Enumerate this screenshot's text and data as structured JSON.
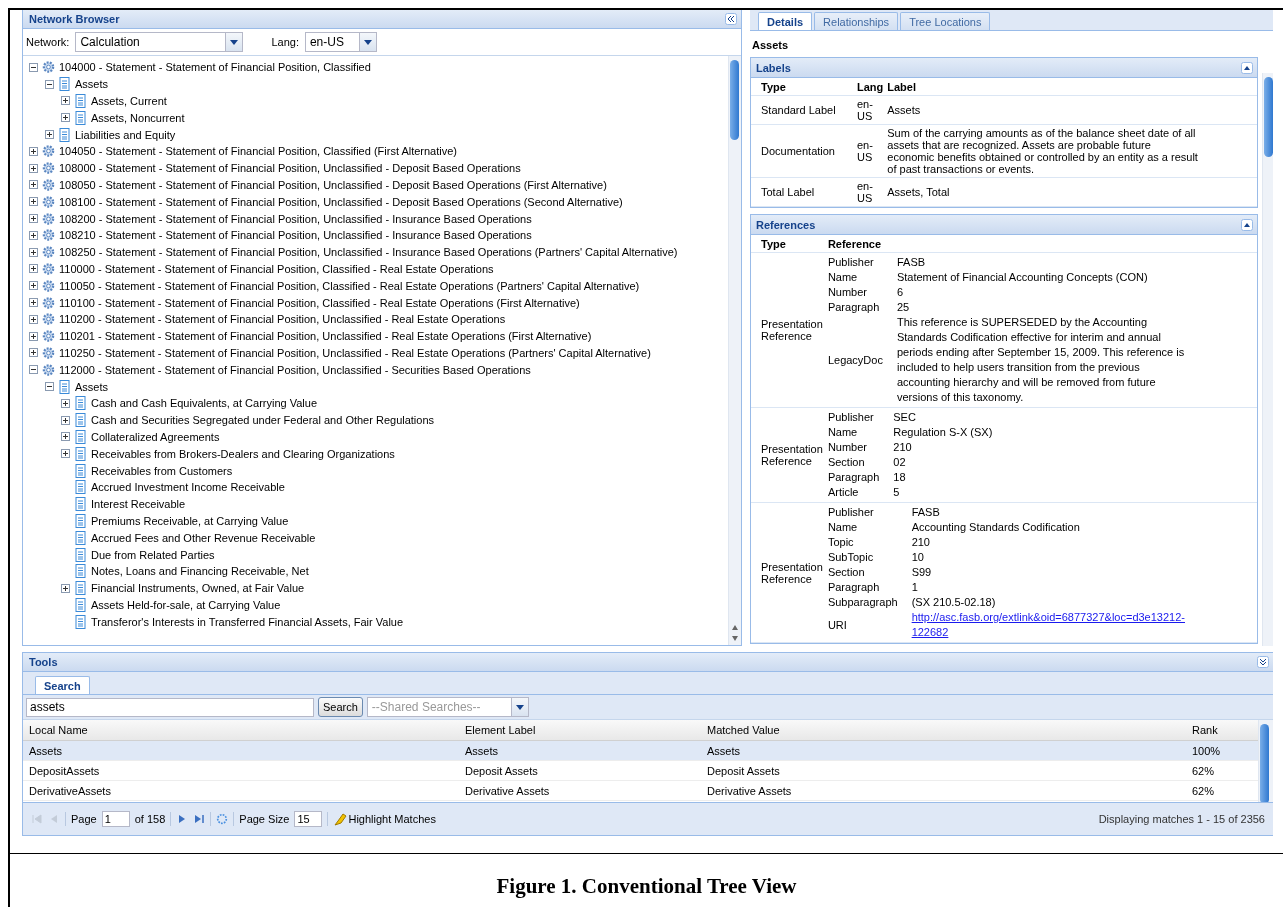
{
  "network_browser": {
    "title": "Network Browser",
    "network_label": "Network:",
    "network_value": "Calculation",
    "lang_label": "Lang:",
    "lang_value": "en-US",
    "tree": [
      {
        "text": "104000 - Statement - Statement of Financial Position, Classified",
        "kind": "network",
        "expanded": true,
        "children": [
          {
            "text": "Assets",
            "kind": "concept",
            "expanded": true,
            "children": [
              {
                "text": "Assets, Current",
                "kind": "concept",
                "expanded": false
              },
              {
                "text": "Assets, Noncurrent",
                "kind": "concept",
                "expanded": false
              }
            ]
          },
          {
            "text": "Liabilities and Equity",
            "kind": "concept",
            "expanded": false
          }
        ]
      },
      {
        "text": "104050 - Statement - Statement of Financial Position, Classified (First Alternative)",
        "kind": "network",
        "expanded": false
      },
      {
        "text": "108000 - Statement - Statement of Financial Position, Unclassified - Deposit Based Operations",
        "kind": "network",
        "expanded": false
      },
      {
        "text": "108050 - Statement - Statement of Financial Position, Unclassified - Deposit Based Operations (First Alternative)",
        "kind": "network",
        "expanded": false
      },
      {
        "text": "108100 - Statement - Statement of Financial Position, Unclassified - Deposit Based Operations (Second Alternative)",
        "kind": "network",
        "expanded": false
      },
      {
        "text": "108200 - Statement - Statement of Financial Position, Unclassified - Insurance Based Operations",
        "kind": "network",
        "expanded": false
      },
      {
        "text": "108210 - Statement - Statement of Financial Position, Unclassified - Insurance Based Operations",
        "kind": "network",
        "expanded": false
      },
      {
        "text": "108250 - Statement - Statement of Financial Position, Unclassified - Insurance Based Operations (Partners' Capital Alternative)",
        "kind": "network",
        "expanded": false
      },
      {
        "text": "110000 - Statement - Statement of Financial Position, Classified - Real Estate Operations",
        "kind": "network",
        "expanded": false
      },
      {
        "text": "110050 - Statement - Statement of Financial Position, Classified - Real Estate Operations (Partners' Capital Alternative)",
        "kind": "network",
        "expanded": false
      },
      {
        "text": "110100 - Statement - Statement of Financial Position, Classified - Real Estate Operations (First Alternative)",
        "kind": "network",
        "expanded": false
      },
      {
        "text": "110200 - Statement - Statement of Financial Position, Unclassified - Real Estate Operations",
        "kind": "network",
        "expanded": false
      },
      {
        "text": "110201 - Statement - Statement of Financial Position, Unclassified - Real Estate Operations (First Alternative)",
        "kind": "network",
        "expanded": false
      },
      {
        "text": "110250 - Statement - Statement of Financial Position, Unclassified - Real Estate Operations (Partners' Capital Alternative)",
        "kind": "network",
        "expanded": false
      },
      {
        "text": "112000 - Statement - Statement of Financial Position, Unclassified - Securities Based Operations",
        "kind": "network",
        "expanded": true,
        "children": [
          {
            "text": "Assets",
            "kind": "concept",
            "expanded": true,
            "children": [
              {
                "text": "Cash and Cash Equivalents, at Carrying Value",
                "kind": "concept",
                "expanded": false
              },
              {
                "text": "Cash and Securities Segregated under Federal and Other Regulations",
                "kind": "concept",
                "expanded": false
              },
              {
                "text": "Collateralized Agreements",
                "kind": "concept",
                "expanded": false
              },
              {
                "text": "Receivables from Brokers-Dealers and Clearing Organizations",
                "kind": "concept",
                "expanded": false
              },
              {
                "text": "Receivables from Customers",
                "kind": "leaf"
              },
              {
                "text": "Accrued Investment Income Receivable",
                "kind": "leaf"
              },
              {
                "text": "Interest Receivable",
                "kind": "leaf"
              },
              {
                "text": "Premiums Receivable, at Carrying Value",
                "kind": "leaf"
              },
              {
                "text": "Accrued Fees and Other Revenue Receivable",
                "kind": "leaf"
              },
              {
                "text": "Due from Related Parties",
                "kind": "leaf"
              },
              {
                "text": "Notes, Loans and Financing Receivable, Net",
                "kind": "leaf"
              },
              {
                "text": "Financial Instruments, Owned, at Fair Value",
                "kind": "concept",
                "expanded": false
              },
              {
                "text": "Assets Held-for-sale, at Carrying Value",
                "kind": "leaf"
              },
              {
                "text": "Transferor's Interests in Transferred Financial Assets, Fair Value",
                "kind": "leaf"
              }
            ]
          }
        ]
      }
    ]
  },
  "details": {
    "tabs": [
      {
        "label": "Details",
        "selected": true
      },
      {
        "label": "Relationships",
        "selected": false
      },
      {
        "label": "Tree Locations",
        "selected": false
      }
    ],
    "heading": "Assets",
    "labels": {
      "title": "Labels",
      "columns": [
        "Type",
        "Lang",
        "Label"
      ],
      "rows": [
        {
          "type": "Standard Label",
          "lang": "en-US",
          "label": "Assets"
        },
        {
          "type": "Documentation",
          "lang": "en-US",
          "label": "Sum of the carrying amounts as of the balance sheet date of all assets that are recognized. Assets are probable future economic benefits obtained or controlled by an entity as a result of past transactions or events."
        },
        {
          "type": "Total Label",
          "lang": "en-US",
          "label": "Assets, Total"
        }
      ]
    },
    "references": {
      "title": "References",
      "columns": [
        "Type",
        "Reference"
      ],
      "rows": [
        {
          "type": "Presentation Reference",
          "fields": [
            {
              "key": "Publisher",
              "value": "FASB"
            },
            {
              "key": "Name",
              "value": "Statement of Financial Accounting Concepts (CON)"
            },
            {
              "key": "Number",
              "value": "6"
            },
            {
              "key": "Paragraph",
              "value": "25"
            },
            {
              "key": "LegacyDoc",
              "value": "This reference is SUPERSEDED by the Accounting Standards Codification effective for interim and annual periods ending after September 15, 2009. This reference is included to help users transition from the previous accounting hierarchy and will be removed from future versions of this taxonomy."
            }
          ]
        },
        {
          "type": "Presentation Reference",
          "fields": [
            {
              "key": "Publisher",
              "value": "SEC"
            },
            {
              "key": "Name",
              "value": "Regulation S-X (SX)"
            },
            {
              "key": "Number",
              "value": "210"
            },
            {
              "key": "Section",
              "value": "02"
            },
            {
              "key": "Paragraph",
              "value": "18"
            },
            {
              "key": "Article",
              "value": "5"
            }
          ]
        },
        {
          "type": "Presentation Reference",
          "fields": [
            {
              "key": "Publisher",
              "value": "FASB"
            },
            {
              "key": "Name",
              "value": "Accounting Standards Codification"
            },
            {
              "key": "Topic",
              "value": "210"
            },
            {
              "key": "SubTopic",
              "value": "10"
            },
            {
              "key": "Section",
              "value": "S99"
            },
            {
              "key": "Paragraph",
              "value": "1"
            },
            {
              "key": "Subparagraph",
              "value": "(SX 210.5-02.18)"
            },
            {
              "key": "URI",
              "value": "http://asc.fasb.org/extlink&oid=6877327&loc=d3e13212-122682",
              "kind": "link"
            }
          ]
        }
      ]
    }
  },
  "tools": {
    "title": "Tools",
    "tabs": [
      {
        "label": "Search",
        "selected": true
      }
    ],
    "search_value": "assets",
    "search_button": "Search",
    "shared_placeholder": "--Shared Searches--",
    "columns": [
      "Local Name",
      "Element Label",
      "Matched Value",
      "Rank"
    ],
    "rows": [
      {
        "cells": [
          "Assets",
          "Assets",
          "Assets",
          "100%"
        ],
        "selected": true
      },
      {
        "cells": [
          "DepositAssets",
          "Deposit Assets",
          "Deposit Assets",
          "62%"
        ],
        "selected": false
      },
      {
        "cells": [
          "DerivativeAssets",
          "Derivative Assets",
          "Derivative Assets",
          "62%"
        ],
        "selected": false
      }
    ],
    "paging": {
      "page_label": "Page",
      "page": "1",
      "of": "of 158",
      "size_label": "Page Size",
      "size": "15",
      "highlight": "Highlight Matches",
      "status": "Displaying matches 1 - 15 of 2356"
    }
  },
  "caption": "Figure 1. Conventional Tree View"
}
